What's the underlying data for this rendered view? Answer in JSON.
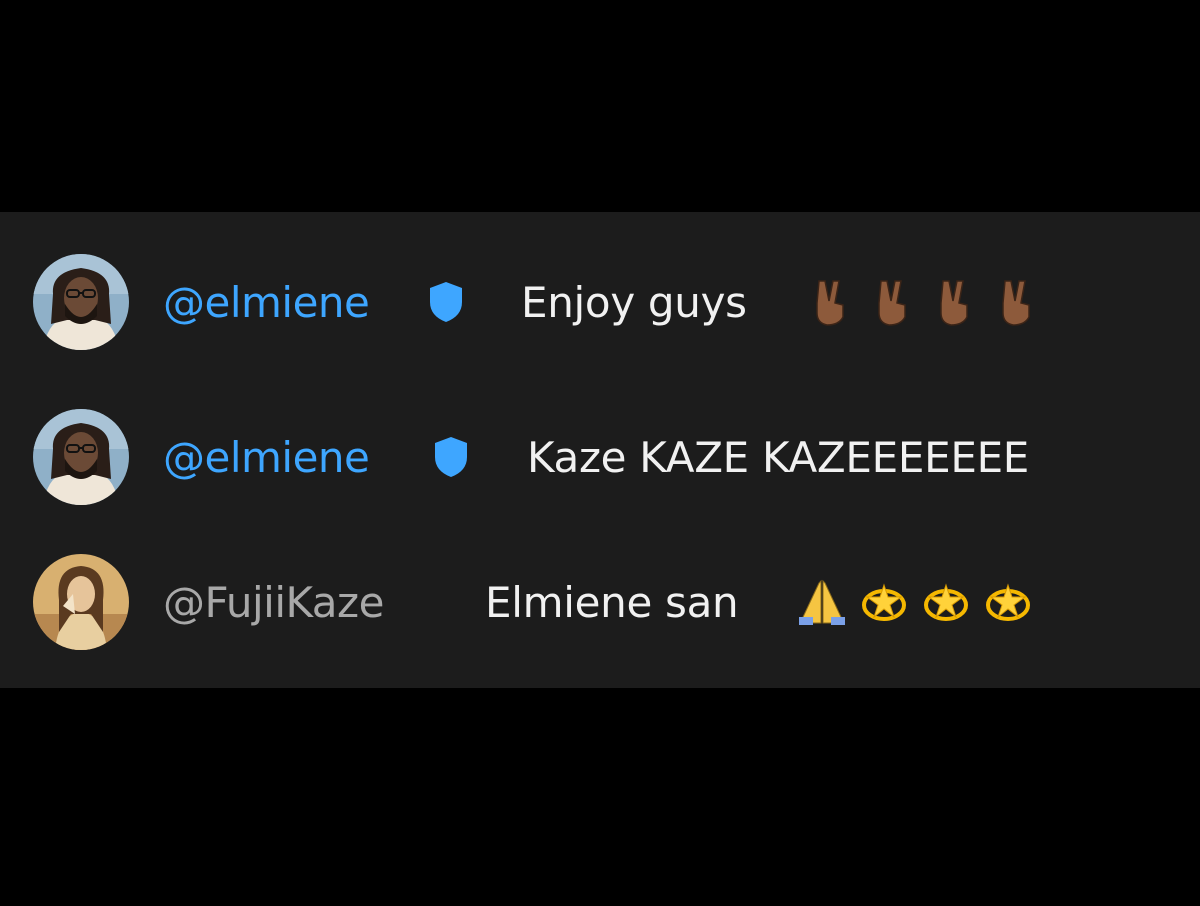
{
  "messages": [
    {
      "username": "@elmiene",
      "is_moderator": true,
      "text": "Enjoy guys",
      "emojis": [
        "victory-hand-medium-dark",
        "victory-hand-medium-dark",
        "victory-hand-medium-dark",
        "victory-hand-medium-dark"
      ]
    },
    {
      "username": "@elmiene",
      "is_moderator": true,
      "text": "Kaze KAZE KAZEEEEEEE",
      "emojis": []
    },
    {
      "username": "@FujiiKaze",
      "is_moderator": false,
      "text": "Elmiene san",
      "emojis": [
        "folded-hands",
        "dizzy-star",
        "dizzy-star",
        "dizzy-star"
      ]
    }
  ],
  "colors": {
    "background": "#000000",
    "panel": "#1c1c1c",
    "moderator_name": "#3ea6ff",
    "regular_name": "#a8a8a8",
    "message_text": "#f1f1f1"
  }
}
